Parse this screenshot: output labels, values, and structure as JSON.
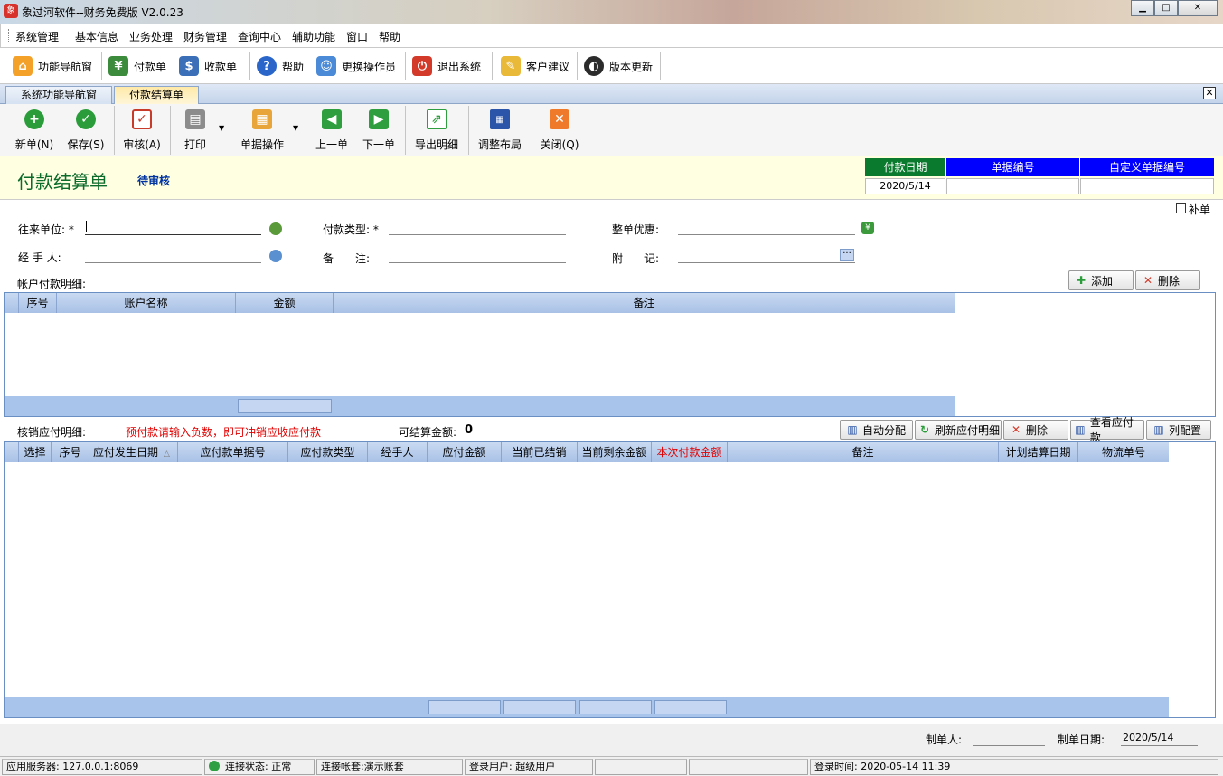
{
  "window": {
    "title": "象过河软件--财务免费版 V2.0.23"
  },
  "menu": [
    "系统管理",
    "基本信息",
    "业务处理",
    "财务管理",
    "查询中心",
    "辅助功能",
    "窗口",
    "帮助"
  ],
  "main_toolbar": [
    "功能导航窗",
    "付款单",
    "收款单",
    "帮助",
    "更换操作员",
    "退出系统",
    "客户建议",
    "版本更新"
  ],
  "tabs": [
    "系统功能导航窗",
    "付款结算单"
  ],
  "form_toolbar": [
    "新单(N)",
    "保存(S)",
    "审核(A)",
    "打印",
    "单据操作",
    "上一单",
    "下一单",
    "导出明细",
    "调整布局",
    "关闭(Q)"
  ],
  "header": {
    "title": "付款结算单",
    "status": "待审核",
    "cols": [
      "付款日期",
      "单据编号",
      "自定义单据编号"
    ],
    "values": [
      "2020/5/14",
      "",
      ""
    ]
  },
  "supplement_label": "补单",
  "fields": {
    "partner": "往来单位: *",
    "pay_type": "付款类型: *",
    "discount": "整单优惠:",
    "handler": "经 手 人:",
    "note": "备　　注:",
    "attach": "附　　记:",
    "ellipsis": "···"
  },
  "account_section": {
    "label": "帐户付款明细:",
    "add": "添加",
    "delete": "删除",
    "columns": [
      "序号",
      "账户名称",
      "金额",
      "备注"
    ]
  },
  "payable_section": {
    "label": "核销应付明细:",
    "hint": "预付款请输入负数，即可冲销应收应付款",
    "settle_label": "可结算金额:",
    "settle_value": "0",
    "buttons": [
      "自动分配",
      "刷新应付明细",
      "删除",
      "查看应付款",
      "列配置"
    ],
    "columns": [
      "选择",
      "序号",
      "应付发生日期",
      "应付款单据号",
      "应付款类型",
      "经手人",
      "应付金额",
      "当前已结销",
      "当前剩余金额",
      "本次付款金额",
      "备注",
      "计划结算日期",
      "物流单号"
    ]
  },
  "footer": {
    "creator_label": "制单人:",
    "creator": "",
    "date_label": "制单日期:",
    "date": "2020/5/14"
  },
  "status_bar": {
    "server": "应用服务器: 127.0.0.1:8069",
    "conn": "连接状态: 正常",
    "account": "连接帐套:演示账套",
    "user": "登录用户: 超级用户",
    "login_time": "登录时间: 2020-05-14 11:39"
  },
  "colors": {
    "accent_blue": "#0000ff",
    "green_head": "#0a7a2e",
    "title_green": "#0b6b2b",
    "warn_red": "#e00000"
  }
}
